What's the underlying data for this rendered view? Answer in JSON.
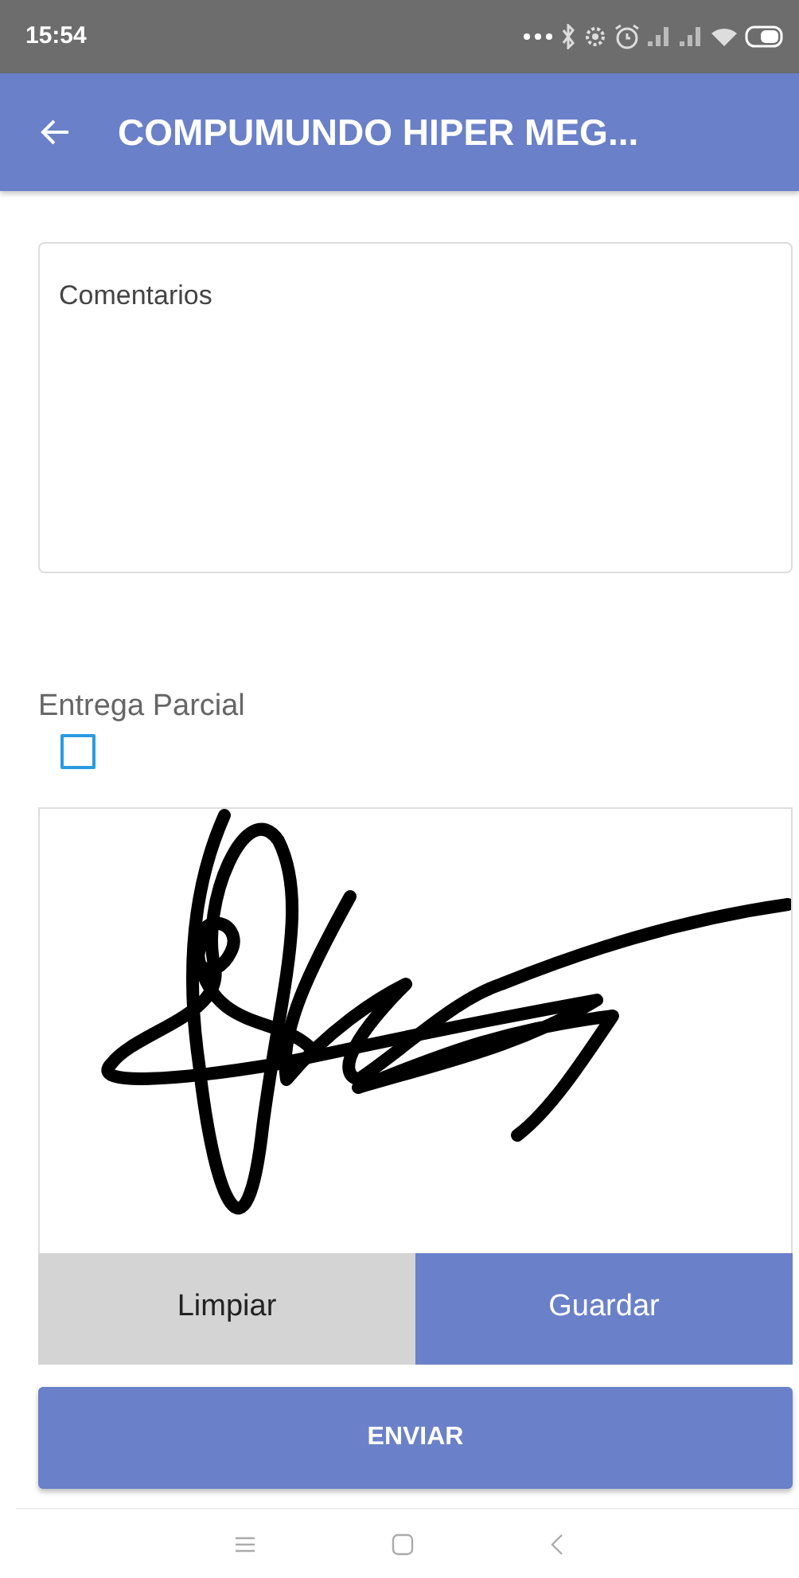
{
  "status_bar": {
    "time": "15:54"
  },
  "app_bar": {
    "title": "COMPUMUNDO HIPER MEG..."
  },
  "comments": {
    "placeholder": "Comentarios"
  },
  "partial_delivery": {
    "label": "Entrega Parcial",
    "checked": false
  },
  "signature_pad": {
    "buttons": [
      {
        "label": "Limpiar",
        "kind": "secondary"
      },
      {
        "label": "Guardar",
        "kind": "primary"
      }
    ]
  },
  "submit": {
    "label": "ENVIAR"
  }
}
